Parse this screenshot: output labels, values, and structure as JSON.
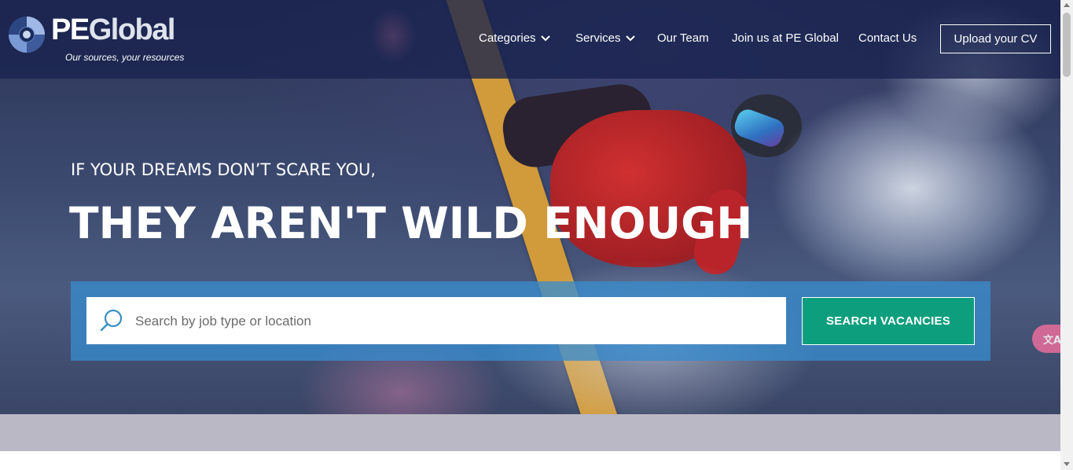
{
  "brand": {
    "name_pe": "PE",
    "name_global": "Global",
    "tagline": "Our sources, your resources"
  },
  "nav": {
    "items": [
      {
        "label": "Categories",
        "has_dropdown": true
      },
      {
        "label": "Services",
        "has_dropdown": true
      },
      {
        "label": "Our Team",
        "has_dropdown": false
      },
      {
        "label": "Join us at PE Global",
        "has_dropdown": false
      },
      {
        "label": "Contact Us",
        "has_dropdown": false
      }
    ],
    "cta_label": "Upload your CV"
  },
  "hero": {
    "tagline": "IF YOUR DREAMS DON’T SCARE YOU,",
    "headline": "THEY AREN'T WILD ENOUGH"
  },
  "search": {
    "placeholder": "Search by job type or location",
    "value": "",
    "button_label": "SEARCH VACANCIES"
  },
  "translate_widget": {
    "glyph": "文A"
  },
  "colors": {
    "header_bg": "#18224e",
    "search_panel": "#388ccd",
    "search_button": "#0d9e7d",
    "strip": "#b9b8c4",
    "translate_widget": "#e96e9b"
  }
}
